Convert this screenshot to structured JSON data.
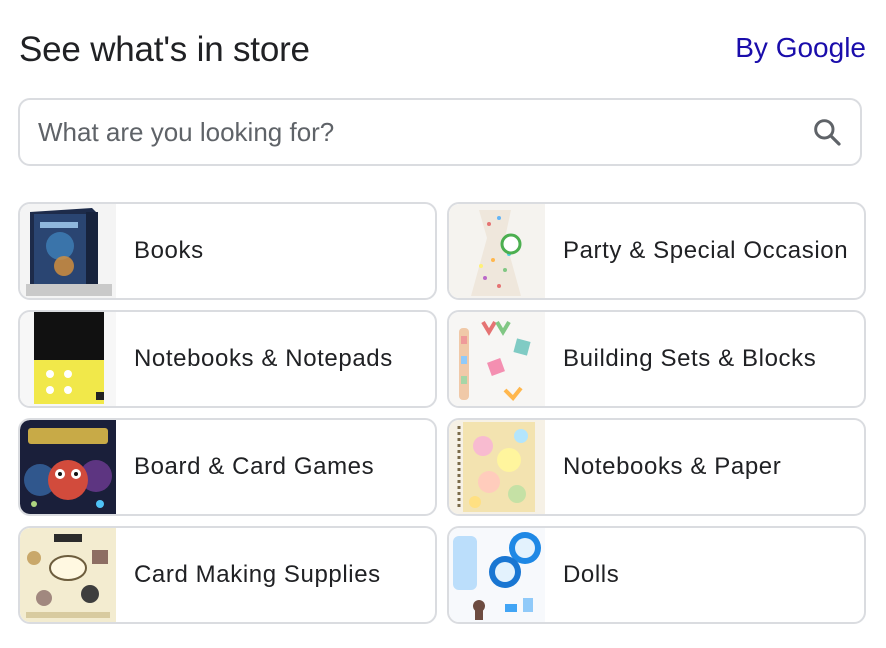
{
  "header": {
    "title": "See what's in store",
    "by_link": "By Google"
  },
  "search": {
    "placeholder": "What are you looking for?",
    "icon": "search-icon"
  },
  "categories": [
    {
      "label": "Books",
      "icon": "books-thumbnail"
    },
    {
      "label": "Party & Special Occasion",
      "icon": "party-bag-thumbnail"
    },
    {
      "label": "Notebooks & Notepads",
      "icon": "notebook-thumbnail"
    },
    {
      "label": "Building Sets & Blocks",
      "icon": "building-blocks-thumbnail"
    },
    {
      "label": "Board & Card Games",
      "icon": "board-game-thumbnail"
    },
    {
      "label": "Notebooks & Paper",
      "icon": "floral-notebook-thumbnail"
    },
    {
      "label": "Card Making Supplies",
      "icon": "card-making-thumbnail"
    },
    {
      "label": "Dolls",
      "icon": "dolls-thumbnail"
    }
  ]
}
